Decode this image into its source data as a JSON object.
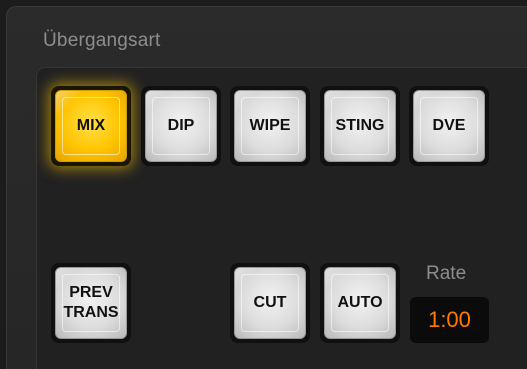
{
  "panel": {
    "title": "Übergangsart"
  },
  "transition_buttons": [
    {
      "label": "MIX",
      "active": true
    },
    {
      "label": "DIP",
      "active": false
    },
    {
      "label": "WIPE",
      "active": false
    },
    {
      "label": "STING",
      "active": false
    },
    {
      "label": "DVE",
      "active": false
    }
  ],
  "controls": {
    "prev_trans_line1": "PREV",
    "prev_trans_line2": "TRANS",
    "cut_label": "CUT",
    "auto_label": "AUTO"
  },
  "rate": {
    "label": "Rate",
    "value": "1:00"
  },
  "colors": {
    "active_button": "#ffc400",
    "rate_text": "#ff7a00",
    "background": "#1c1c1c"
  }
}
